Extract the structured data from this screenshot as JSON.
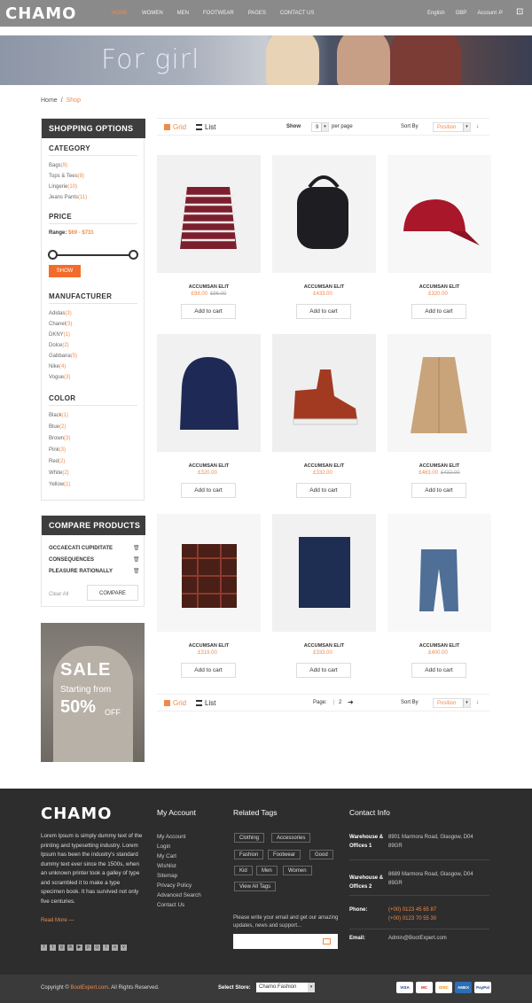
{
  "header": {
    "logo": "CHAMO",
    "nav": [
      "HOME",
      "WOMEN",
      "MEN",
      "FOOTWEAR",
      "PAGES",
      "CONTACT US"
    ],
    "right": [
      "English",
      "GBP",
      "Account"
    ]
  },
  "banner": {
    "title": "For girl"
  },
  "breadcrumb": {
    "home": "Home",
    "current": "Shop"
  },
  "sidebar": {
    "title": "SHOPPING OPTIONS",
    "category": {
      "title": "CATEGORY",
      "items": [
        {
          "name": "Bags",
          "count": "(9)"
        },
        {
          "name": "Tops & Tees",
          "count": "(8)"
        },
        {
          "name": "Lingerie",
          "count": "(10)"
        },
        {
          "name": "Jeans Pants",
          "count": "(11)"
        }
      ]
    },
    "price": {
      "title": "PRICE",
      "range_label": "Range:",
      "range_value": "$69 - $731",
      "show": "SHOW"
    },
    "manufacturer": {
      "title": "MANUFACTURER",
      "items": [
        {
          "name": "Adidas",
          "count": "(3)"
        },
        {
          "name": "Chanel",
          "count": "(3)"
        },
        {
          "name": "DKNY",
          "count": "(1)"
        },
        {
          "name": "Dolce",
          "count": "(2)"
        },
        {
          "name": "Gabbana",
          "count": "(5)"
        },
        {
          "name": "Nike",
          "count": "(4)"
        },
        {
          "name": "Vogue",
          "count": "(3)"
        }
      ]
    },
    "color": {
      "title": "COLOR",
      "items": [
        {
          "name": "Black",
          "count": "(1)"
        },
        {
          "name": "Blue",
          "count": "(2)"
        },
        {
          "name": "Brown",
          "count": "(3)"
        },
        {
          "name": "Pink",
          "count": "(3)"
        },
        {
          "name": "Red",
          "count": "(2)"
        },
        {
          "name": "White",
          "count": "(2)"
        },
        {
          "name": "Yellow",
          "count": "(1)"
        }
      ]
    }
  },
  "compare": {
    "title": "COMPARE PRODUCTS",
    "items": [
      "OCCAECATI CUPIDITATE",
      "CONSEQUENCES",
      "PLEASURE RATIONALLY"
    ],
    "clear": "Clear All",
    "button": "COMPARE"
  },
  "sale": {
    "title": "SALE",
    "sub": "Starting from",
    "pct": "50%",
    "off": "OFF"
  },
  "toolbar": {
    "grid": "Grid",
    "list": "List",
    "show": "Show",
    "per_page_value": "9",
    "per_page": "per page",
    "sort": "Sort By",
    "sort_value": "Position",
    "page_label": "Page:",
    "page_value": "2"
  },
  "products": [
    {
      "name": "ACCUMSAN ELIT",
      "price": "£98.00",
      "old": "£96.00",
      "cart": "Add to cart",
      "img": "striped-sweater"
    },
    {
      "name": "ACCUMSAN ELIT",
      "price": "£433.00",
      "old": "",
      "cart": "Add to cart",
      "img": "black-backpack"
    },
    {
      "name": "ACCUMSAN ELIT",
      "price": "£320.00",
      "old": "",
      "cart": "Add to cart",
      "img": "red-cap"
    },
    {
      "name": "ACCUMSAN ELIT",
      "price": "£320.00",
      "old": "",
      "cart": "Add to cart",
      "img": "navy-beanie"
    },
    {
      "name": "ACCUMSAN ELIT",
      "price": "£332.00",
      "old": "",
      "cart": "Add to cart",
      "img": "brown-sneaker"
    },
    {
      "name": "ACCUMSAN ELIT",
      "price": "£463.00",
      "old": "£432.00",
      "cart": "Add to cart",
      "img": "beige-trench-coat"
    },
    {
      "name": "ACCUMSAN ELIT",
      "price": "£319.00",
      "old": "",
      "cart": "Add to cart",
      "img": "patterned-scarf"
    },
    {
      "name": "ACCUMSAN ELIT",
      "price": "£333.00",
      "old": "",
      "cart": "Add to cart",
      "img": "navy-blanket"
    },
    {
      "name": "ACCUMSAN ELIT",
      "price": "£400.00",
      "old": "",
      "cart": "Add to cart",
      "img": "blue-jeans"
    }
  ],
  "footer": {
    "logo": "CHAMO",
    "about": "Lorem Ipsum is simply dummy text of the printing and typesetting industry. Lorem Ipsum has been the industry's standard dummy text ever since the 1500s, when an unknown printer took a galley of type and scrambled it to make a type specimen book. It has survived not only five centuries.",
    "read_more": "Read More",
    "account_title": "My Account",
    "account_links": [
      "My Account",
      "Login",
      "My Cart",
      "Wishlist",
      "Sitemap",
      "Privacy Policy",
      "Advanced Search",
      "Contact Us"
    ],
    "tags_title": "Related Tags",
    "tags": [
      "Clothing",
      "Accessories",
      "Fashion",
      "Footwear",
      "Good",
      "Kid",
      "Men",
      "Women",
      "View All Tags"
    ],
    "newsletter": "Please write your email and get our amazing updates, news and support...",
    "contact_title": "Contact Info",
    "contact": [
      {
        "label": "Warehouse & Offices 1",
        "value": "8901 Marmora Road, Glasgow, D04 89GR",
        "orange": false
      },
      {
        "label": "Warehouse & Offices 2",
        "value": "8689 Marmora Road, Glasgow, D04 89GR",
        "orange": false
      },
      {
        "label": "Phone:",
        "value": "(+00) 0123 45 65 87\n(+00) 0123 70 55 30",
        "orange": true
      },
      {
        "label": "Email:",
        "value": "Admin@BootExpert.com",
        "orange": false
      }
    ]
  },
  "bottom": {
    "copyright_pre": "Copyright ©",
    "brand": "BootExpert.com",
    "copyright_post": ". All Rights Reserved.",
    "store_label": "Select Store:",
    "store_value": "Chamo Fashion",
    "payments": [
      "VISA",
      "MC",
      "DISC",
      "AMEX",
      "PayPal"
    ]
  },
  "colors": {
    "accent": "#f08a4b",
    "dark": "#3d3d3d",
    "footer": "#2d2d2d"
  }
}
